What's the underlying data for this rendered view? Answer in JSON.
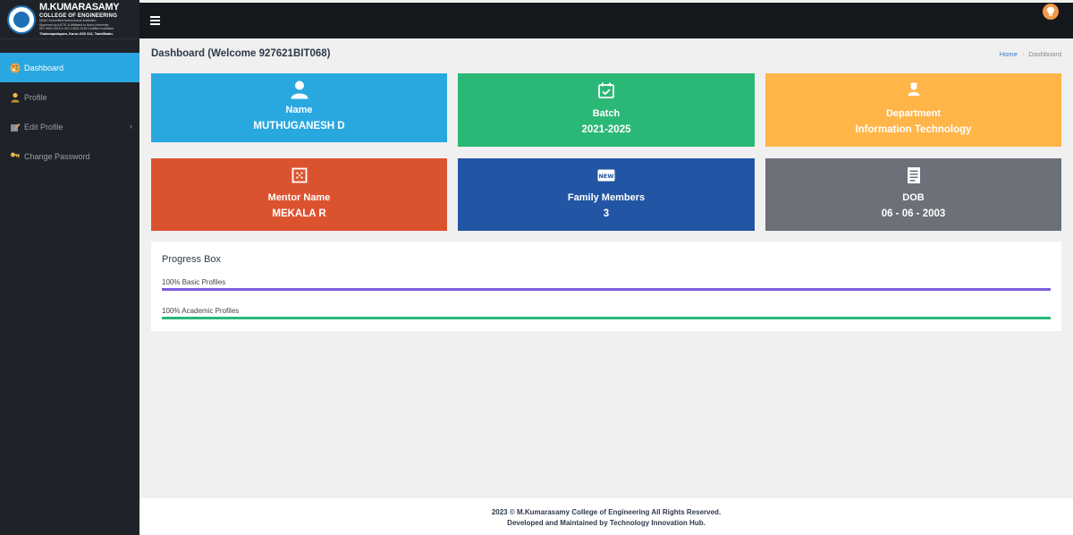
{
  "brand": {
    "title": "M.KUMARASAMY",
    "subtitle": "COLLEGE OF ENGINEERING",
    "line1": "NAAC Accredited Autonomous Institution",
    "line2": "Approved by AICTE & Affiliated to Anna University",
    "line3": "ISO 9001:2015 & ISO 14001:2015 Certified Institution",
    "location": "Thalavapalayam, Karur-639 113, TamilNadu."
  },
  "sidebar": {
    "items": [
      {
        "label": "Dashboard",
        "icon": "palette-icon",
        "active": true
      },
      {
        "label": "Profile",
        "icon": "user-icon",
        "active": false
      },
      {
        "label": "Edit Profile",
        "icon": "edit-icon",
        "active": false
      },
      {
        "label": "Change Password",
        "icon": "key-icon",
        "active": false
      }
    ]
  },
  "header": {
    "title": "Dashboard (Welcome 927621BIT068)",
    "breadcrumb": [
      "Home",
      "Dashboard"
    ]
  },
  "cards": [
    {
      "label": "Name",
      "value": "MUTHUGANESH D",
      "icon": "user-icon",
      "color": "#29a8e0"
    },
    {
      "label": "Batch",
      "value": "2021-2025",
      "icon": "calendar-check-icon",
      "color": "#2bb877"
    },
    {
      "label": "Department",
      "value": "Information Technology",
      "icon": "person-badge-icon",
      "color": "#ffb548"
    },
    {
      "label": "Mentor Name",
      "value": "MEKALA R",
      "icon": "grid-square-icon",
      "color": "#db532e"
    },
    {
      "label": "Family Members",
      "value": "3",
      "icon": "new-badge-icon",
      "color": "#2255a3"
    },
    {
      "label": "DOB",
      "value": "06 - 06 - 2003",
      "icon": "document-icon",
      "color": "#6b7079"
    }
  ],
  "progress": {
    "title": "Progress Box",
    "items": [
      {
        "label": "100% Basic Profiles",
        "percent": 100,
        "color": "#7b5ee0"
      },
      {
        "label": "100% Academic Profiles",
        "percent": 100,
        "color": "#2bb877"
      }
    ]
  },
  "footer": {
    "line1": "2023 © M.Kumarasamy College of Engineering All Rights Reserved.",
    "line2": "Developed and Maintained by Technology Innovation Hub."
  }
}
